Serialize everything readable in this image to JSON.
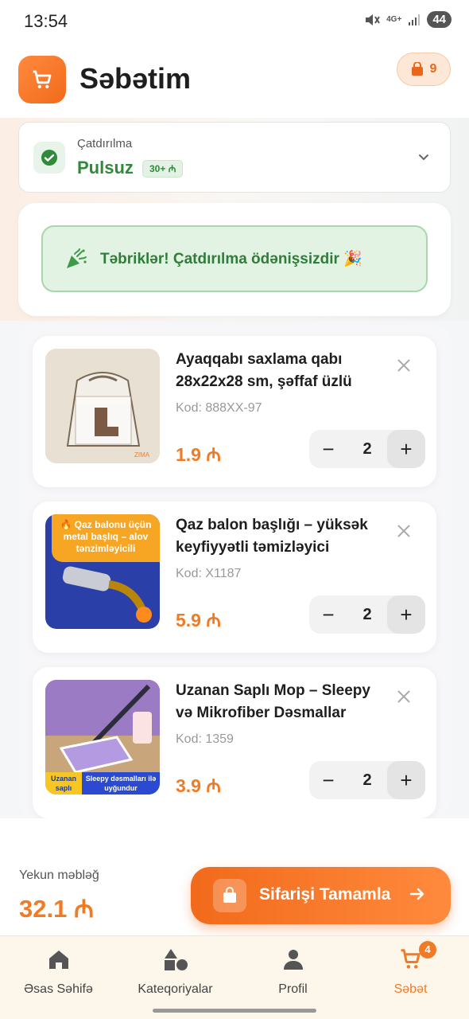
{
  "status_bar": {
    "time": "13:54",
    "network": "4G+",
    "battery": "44",
    "icons": [
      "mute-icon",
      "signal-icon"
    ]
  },
  "header": {
    "title": "Səbətim",
    "bag_count": "9",
    "logo_icon": "cart-icon"
  },
  "delivery": {
    "label": "Çatdırılma",
    "value": "Pulsuz",
    "chip": "30+ ₼"
  },
  "congrats": {
    "text": "Təbriklər! Çatdırılma ödənişsizdir 🎉"
  },
  "cart_items": [
    {
      "name": "Ayaqqabı saxlama qabı 28x22x28 sm, şəffaf üzlü",
      "code": "Kod: 888XX-97",
      "price": "1.9 ₼",
      "quantity": "2"
    },
    {
      "name": "Qaz balon başlığı – yüksək keyfiyyətli təmizləyici",
      "code": "Kod: X1187",
      "price": "5.9 ₼",
      "quantity": "2",
      "image_text": "🔥 Qaz balonu üçün metal başlıq – alov tənzimləyicili"
    },
    {
      "name": "Uzanan Saplı Mop – Sleepy və Mikrofiber Dəsmallar",
      "code": "Kod: 1359",
      "price": "3.9 ₼",
      "quantity": "2",
      "image_text_left": "Uzanan saplı",
      "image_text_right": "Sleepy dəsmalları ilə uyğundur"
    }
  ],
  "qty_controls": {
    "minus": "−",
    "plus": "+"
  },
  "footer": {
    "total_label": "Yekun məbləğ",
    "total_value": "32.1 ₼",
    "checkout_label": "Sifarişi Tamamla"
  },
  "nav": {
    "items": [
      {
        "label": "Əsas Səhifə",
        "icon": "home-icon"
      },
      {
        "label": "Kateqoriyalar",
        "icon": "categories-icon"
      },
      {
        "label": "Profil",
        "icon": "profile-icon"
      },
      {
        "label": "Səbət",
        "icon": "cart-icon",
        "badge": "4"
      }
    ]
  },
  "colors": {
    "accent": "#f07b24",
    "success": "#2f8a3a",
    "nav_bg": "#fdf6ea"
  }
}
